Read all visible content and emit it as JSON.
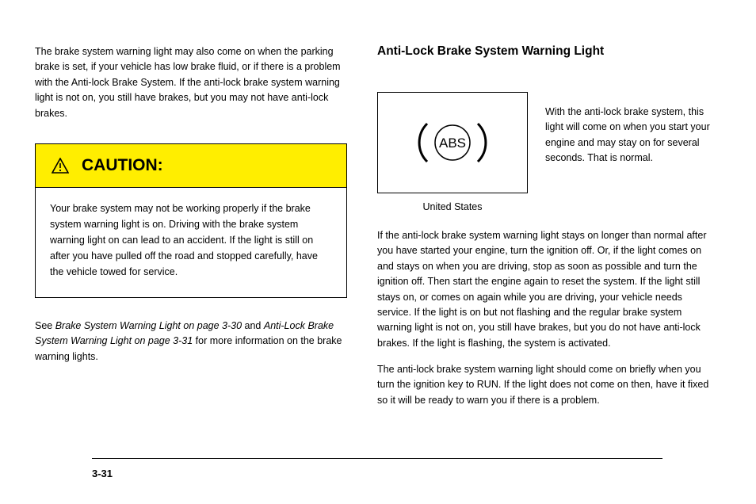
{
  "left": {
    "intro": "The brake system warning light may also come on when the parking brake is set, if your vehicle has low brake fluid, or if there is a problem with the Anti-lock Brake System. If the anti-lock brake system warning light is not on, you still have brakes, but you may not have anti-lock brakes.",
    "caution": {
      "title": "CAUTION:",
      "body": "Your brake system may not be working properly if the brake system warning light is on. Driving with the brake system warning light on can lead to an accident. If the light is still on after you have pulled off the road and stopped carefully, have the vehicle towed for service."
    },
    "tail_nonitalic": "See ",
    "tail_italic_a": "Brake System Warning Light on page 3-30",
    "tail_mid": " and ",
    "tail_italic_b": "Anti-Lock Brake System Warning Light on page 3-31",
    "tail_end": " for more information on the brake warning lights."
  },
  "right": {
    "heading": "Anti-Lock Brake System Warning Light",
    "abs_label": "ABS",
    "caption": "United States",
    "header_para": "With the anti-lock brake system, this light will come on when you start your engine and may stay on for several seconds. That is normal.",
    "para1": "If the anti-lock brake system warning light stays on longer than normal after you have started your engine, turn the ignition off. Or, if the light comes on and stays on when you are driving, stop as soon as possible and turn the ignition off. Then start the engine again to reset the system. If the light still stays on, or comes on again while you are driving, your vehicle needs service. If the light is on but not flashing and the regular brake system warning light is not on, you still have brakes, but you do not have anti-lock brakes. If the light is flashing, the system is activated.",
    "para2": "The anti-lock brake system warning light should come on briefly when you turn the ignition key to RUN. If the light does not come on then, have it fixed so it will be ready to warn you if there is a problem."
  },
  "pageNumber": "3-31"
}
